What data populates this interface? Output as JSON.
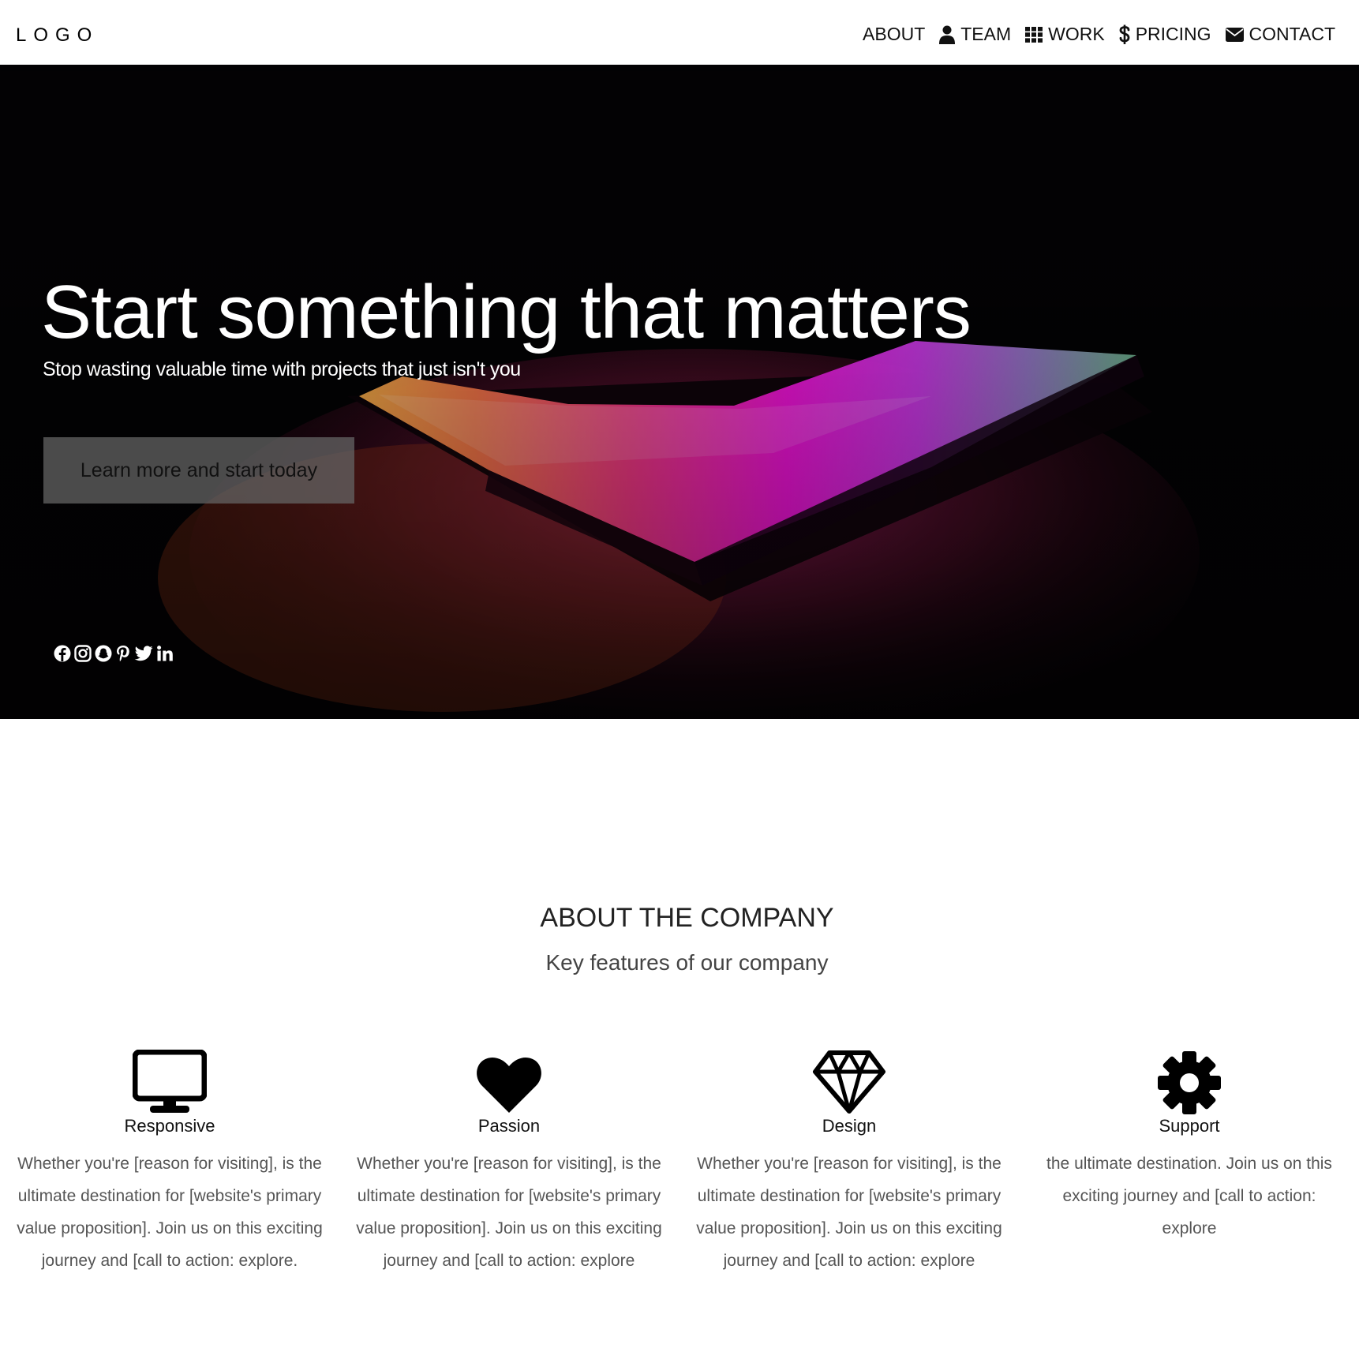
{
  "navbar": {
    "logo": "LOGO",
    "items": [
      {
        "label": "ABOUT",
        "icon": "none"
      },
      {
        "label": "TEAM",
        "icon": "user-icon"
      },
      {
        "label": "WORK",
        "icon": "grid-icon"
      },
      {
        "label": "PRICING",
        "icon": "dollar-icon"
      },
      {
        "label": "CONTACT",
        "icon": "envelope-icon"
      }
    ]
  },
  "hero": {
    "title": "Start something that matters",
    "subtitle": "Stop wasting valuable time with projects that just isn't you",
    "button_label": "Learn more and start today",
    "social_icons": [
      "facebook-icon",
      "instagram-icon",
      "snapchat-icon",
      "pinterest-icon",
      "twitter-icon",
      "linkedin-icon"
    ]
  },
  "about": {
    "title": "ABOUT THE COMPANY",
    "subtitle": "Key features of our company",
    "features": [
      {
        "icon": "monitor-icon",
        "title": "Responsive",
        "text": "Whether you're [reason for visiting], is the ultimate destination for [website's primary value proposition]. Join us on this exciting journey and [call to action: explore."
      },
      {
        "icon": "heart-icon",
        "title": "Passion",
        "text": "Whether you're [reason for visiting], is the ultimate destination for [website's primary value proposition]. Join us on this exciting journey and [call to action: explore"
      },
      {
        "icon": "diamond-icon",
        "title": "Design",
        "text": "Whether you're [reason for visiting], is the ultimate destination for [website's primary value proposition]. Join us on this exciting journey and [call to action: explore"
      },
      {
        "icon": "gear-icon",
        "title": "Support",
        "text": "the ultimate destination. Join us on this exciting journey and [call to action: explore"
      }
    ]
  },
  "colors": {
    "hero_background": "#030204",
    "button_background": "#646464",
    "text_dark": "#111111",
    "text_muted": "#555555"
  }
}
